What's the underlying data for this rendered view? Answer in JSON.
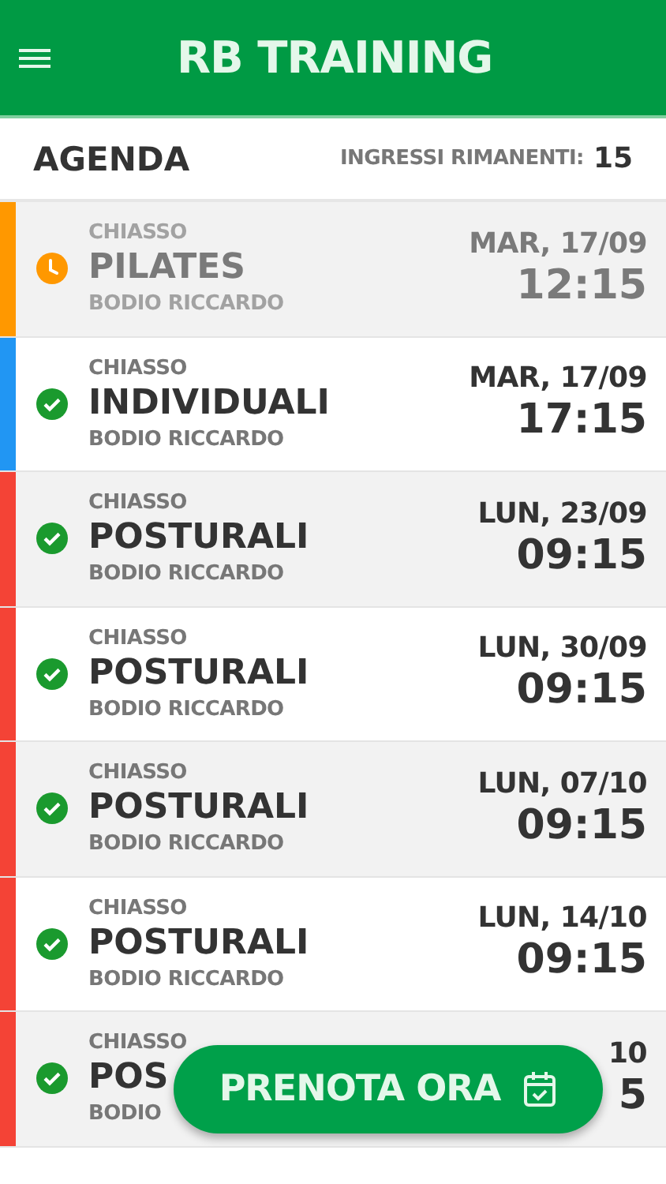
{
  "app_bar": {
    "title": "RB TRAINING"
  },
  "agenda": {
    "title": "AGENDA",
    "remaining_label": "INGRESSI RIMANENTI:",
    "remaining_count": "15"
  },
  "appointments": [
    {
      "location": "CHIASSO",
      "activity": "PILATES",
      "trainer": "BODIO RICCARDO",
      "date": "MAR, 17/09",
      "time": "12:15",
      "kind": "pending",
      "color": "#ff9800"
    },
    {
      "location": "CHIASSO",
      "activity": "INDIVIDUALI",
      "trainer": "BODIO RICCARDO",
      "date": "MAR, 17/09",
      "time": "17:15",
      "kind": "confirmed",
      "color": "#2196f3"
    },
    {
      "location": "CHIASSO",
      "activity": "POSTURALI",
      "trainer": "BODIO RICCARDO",
      "date": "LUN, 23/09",
      "time": "09:15",
      "kind": "confirmed",
      "color": "#f44336"
    },
    {
      "location": "CHIASSO",
      "activity": "POSTURALI",
      "trainer": "BODIO RICCARDO",
      "date": "LUN, 30/09",
      "time": "09:15",
      "kind": "confirmed",
      "color": "#f44336"
    },
    {
      "location": "CHIASSO",
      "activity": "POSTURALI",
      "trainer": "BODIO RICCARDO",
      "date": "LUN, 07/10",
      "time": "09:15",
      "kind": "confirmed",
      "color": "#f44336"
    },
    {
      "location": "CHIASSO",
      "activity": "POSTURALI",
      "trainer": "BODIO RICCARDO",
      "date": "LUN, 14/10",
      "time": "09:15",
      "kind": "confirmed",
      "color": "#f44336"
    },
    {
      "location": "CHIASSO",
      "activity": "POS",
      "trainer": "BODIO",
      "date": "10",
      "time": "5",
      "kind": "confirmed",
      "color": "#f44336"
    }
  ],
  "book_button": {
    "label": "PRENOTA ORA"
  }
}
